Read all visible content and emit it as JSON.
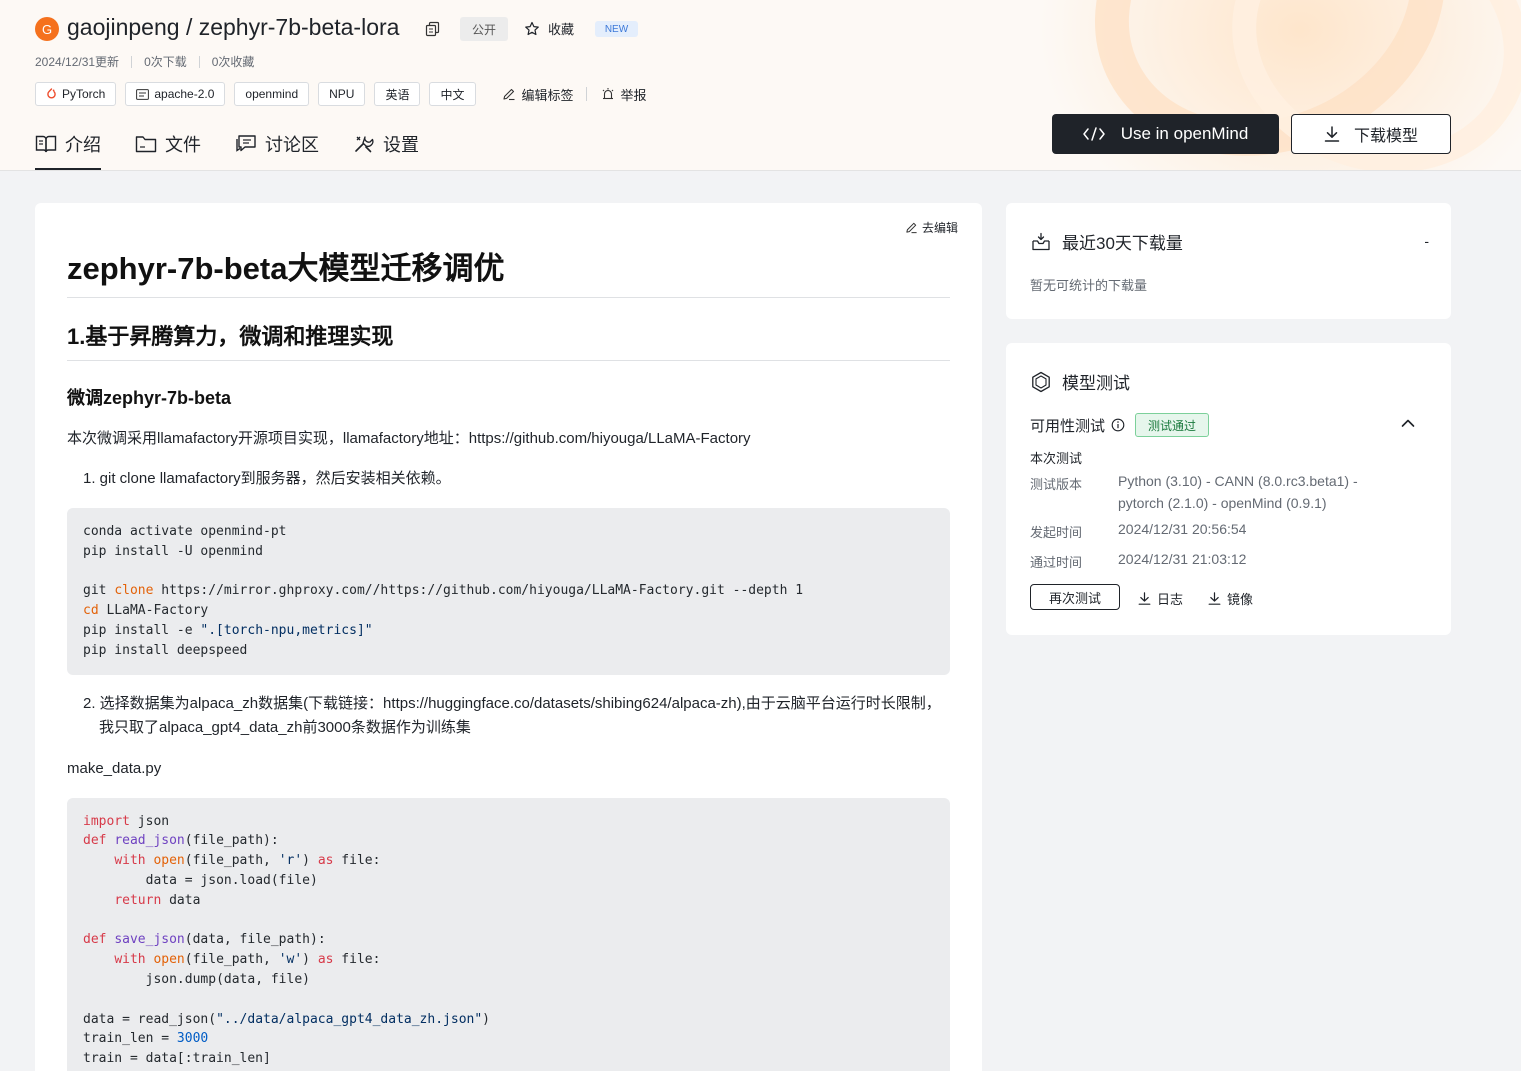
{
  "repo": {
    "avatar_letter": "G",
    "title": "gaojinpeng / zephyr-7b-beta-lora",
    "visibility": "公开",
    "favorite_label": "收藏",
    "new_badge": "NEW",
    "updated": "2024/12/31更新",
    "downloads": "0次下载",
    "favorites": "0次收藏"
  },
  "tags": [
    "PyTorch",
    "apache-2.0",
    "openmind",
    "NPU",
    "英语",
    "中文"
  ],
  "tag_actions": {
    "edit": "编辑标签",
    "report": "举报"
  },
  "tabs": [
    {
      "label": "介绍",
      "icon": "book-icon"
    },
    {
      "label": "文件",
      "icon": "folder-icon"
    },
    {
      "label": "讨论区",
      "icon": "chat-icon"
    },
    {
      "label": "设置",
      "icon": "settings-icon"
    }
  ],
  "actions": {
    "openmind": "Use in openMind",
    "download": "下载模型"
  },
  "doc": {
    "edit_link": "去编辑",
    "h1": "zephyr-7b-beta大模型迁移调优",
    "h2": "1.基于昇腾算力，微调和推理实现",
    "h3": "微调zephyr-7b-beta",
    "intro": "本次微调采用llamafactory开源项目实现，llamafactory地址：https://github.com/hiyouga/LLaMA-Factory",
    "step1": "1. git clone llamafactory到服务器，然后安装相关依赖。",
    "step2": "2. 选择数据集为alpaca_zh数据集(下载链接：https://huggingface.co/datasets/shibing624/alpaca-zh),由于云脑平台运行时长限制，我只取了alpaca_gpt4_data_zh前3000条数据作为训练集",
    "filename": "make_data.py",
    "code1": {
      "l1": "conda activate openmind-pt",
      "l2": "pip install -U openmind",
      "l4_cmd": "git ",
      "l4_kw": "clone",
      "l4_rest": " https://mirror.ghproxy.com//https://github.com/hiyouga/LLaMA-Factory.git --depth 1",
      "l5_kw": "cd",
      "l5_rest": " LLaMA-Factory",
      "l6_a": "pip install -e ",
      "l6_str": "\".[torch-npu,metrics]\"",
      "l7": "pip install deepspeed"
    },
    "code2": {
      "import_kw": "import",
      "import_rest": " json",
      "def_kw": "def",
      "read_fn": "read_json",
      "read_sig": "(file_path):",
      "with_kw": "with",
      "open_bi": "open",
      "open_a": "(file_path, ",
      "r_str": "'r'",
      "as_kw": "as",
      "file_colon": " file:",
      "load_line": "data = json.load(file)",
      "return_kw": "return",
      "return_rest": " data",
      "save_fn": "save_json",
      "save_sig": "(data, file_path):",
      "w_str": "'w'",
      "dump_line": "json.dump(data, file)",
      "data_read_a": "data = read_json(",
      "data_read_str": "\"../data/alpaca_gpt4_data_zh.json\"",
      "data_read_b": ")",
      "train_len_a": "train_len = ",
      "train_len_num": "3000",
      "train_line": "train = data[:train_len]"
    }
  },
  "downloads_card": {
    "title": "最近30天下载量",
    "value": "-",
    "empty_text": "暂无可统计的下载量"
  },
  "test_card": {
    "title": "模型测试",
    "availability_label": "可用性测试",
    "status": "测试通过",
    "this_test": "本次测试",
    "version_label": "测试版本",
    "version_value": "Python (3.10) - CANN (8.0.rc3.beta1) - pytorch (2.1.0) - openMind (0.9.1)",
    "start_label": "发起时间",
    "start_value": "2024/12/31 20:56:54",
    "pass_label": "通过时间",
    "pass_value": "2024/12/31 21:03:12",
    "retest": "再次测试",
    "log": "日志",
    "image": "镜像"
  },
  "colors": {
    "primary_dark": "#1f2329",
    "avatar": "#f5711d",
    "pass_green": "#1b7a3d",
    "code_bg": "#ebecee"
  }
}
